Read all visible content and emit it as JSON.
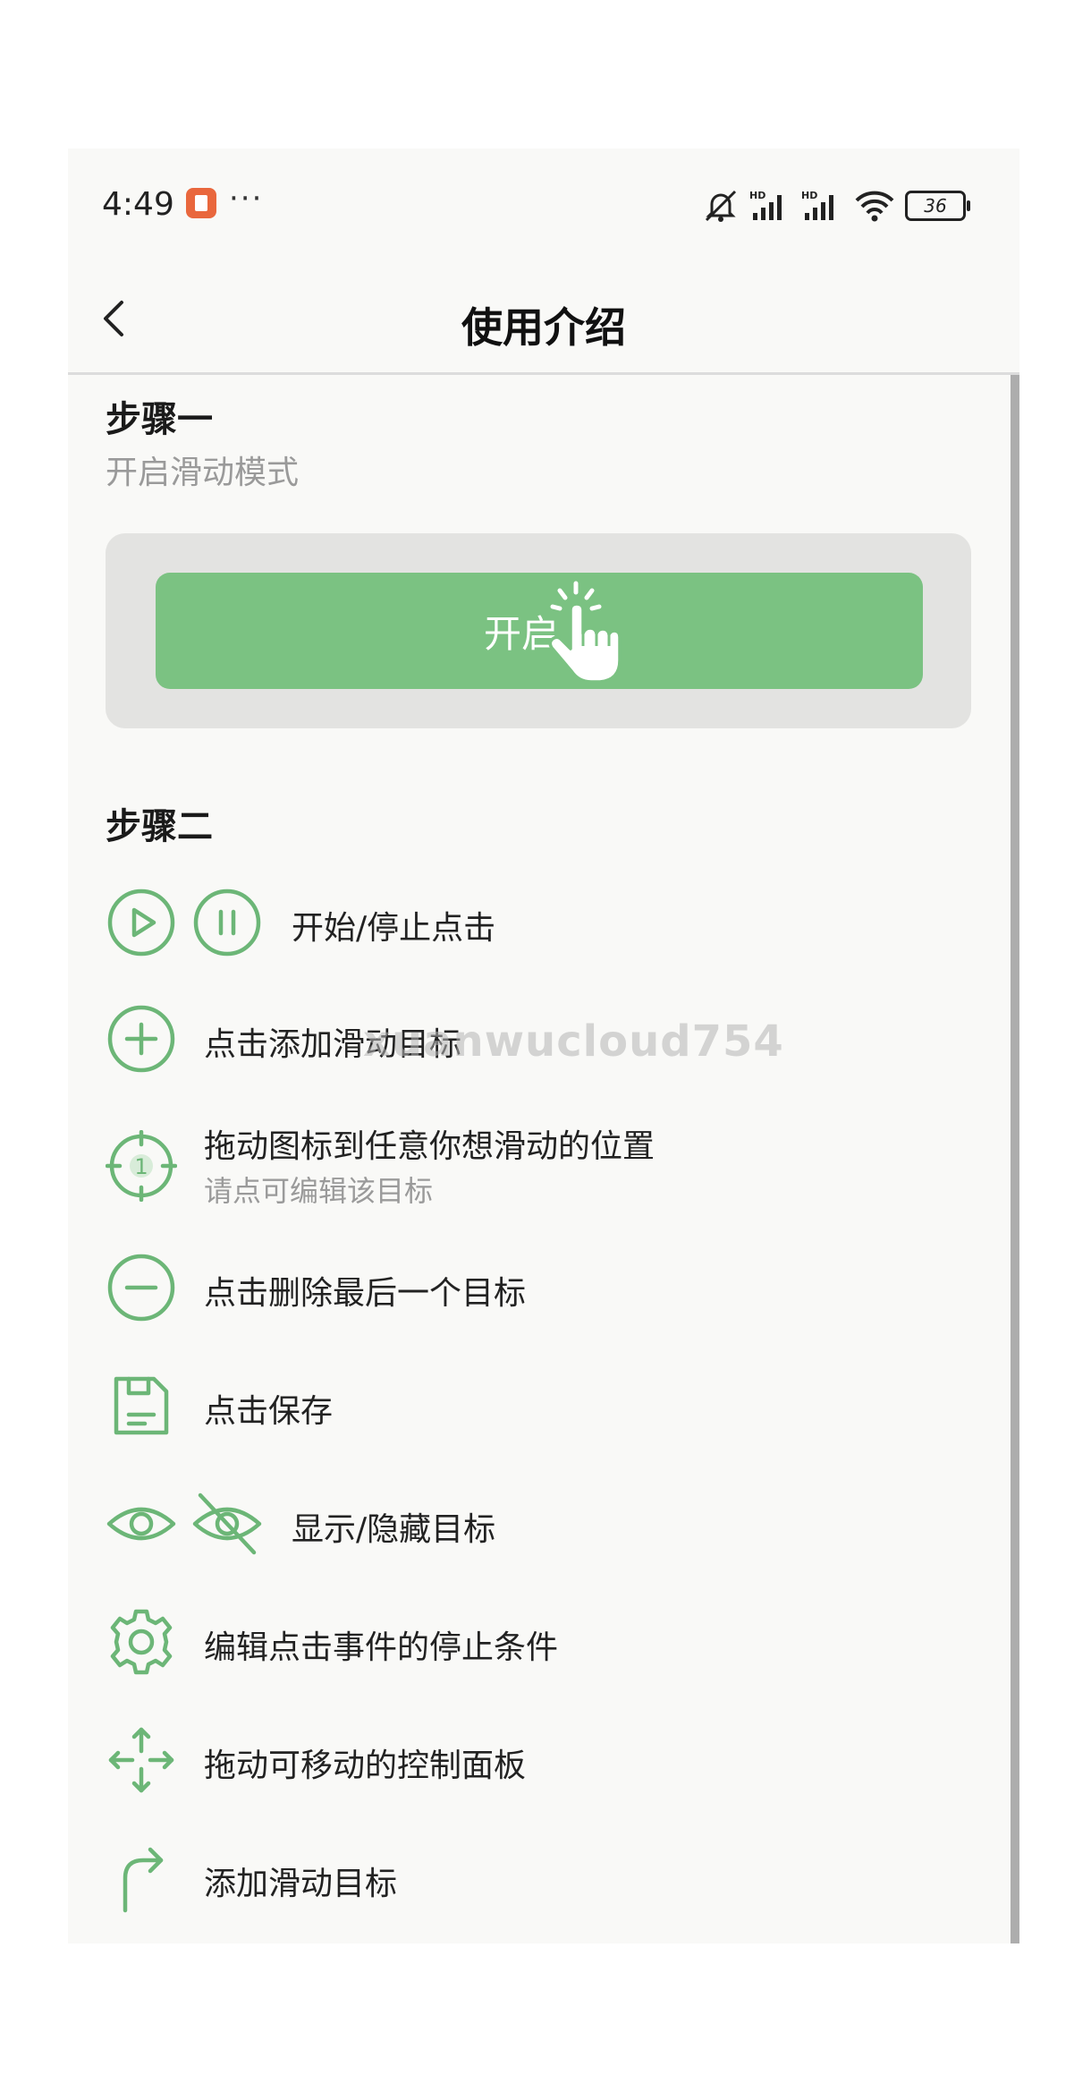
{
  "status_bar": {
    "time": "4:49",
    "more": "···",
    "battery": "36"
  },
  "header": {
    "title": "使用介绍"
  },
  "step1": {
    "title": "步骤一",
    "subtitle": "开启滑动模式",
    "button_label": "开启"
  },
  "step2": {
    "title": "步骤二",
    "items": [
      {
        "text": "开始/停止点击",
        "icons": [
          "play-icon",
          "pause-icon"
        ]
      },
      {
        "text": "点击添加滑动目标",
        "icons": [
          "add-circle-icon"
        ]
      },
      {
        "text": "拖动图标到任意你想滑动的位置",
        "subtext": "请点可编辑该目标",
        "icons": [
          "target-crosshair-icon"
        ]
      },
      {
        "text": "点击删除最后一个目标",
        "icons": [
          "remove-circle-icon"
        ]
      },
      {
        "text": "点击保存",
        "icons": [
          "save-icon"
        ]
      },
      {
        "text": "显示/隐藏目标",
        "icons": [
          "eye-icon",
          "eye-off-icon"
        ]
      },
      {
        "text": "编辑点击事件的停止条件",
        "icons": [
          "gear-icon"
        ]
      },
      {
        "text": "拖动可移动的控制面板",
        "icons": [
          "move-arrows-icon"
        ]
      },
      {
        "text": "添加滑动目标",
        "icons": [
          "swipe-arrow-icon"
        ]
      }
    ]
  },
  "target_icon_number": "1",
  "watermark": "xuanwucloud754",
  "colors": {
    "accent": "#7bc282",
    "icon_green": "#6cb677",
    "page_bg": "#f9f9f7",
    "demo_box_bg": "#e3e3e1"
  }
}
